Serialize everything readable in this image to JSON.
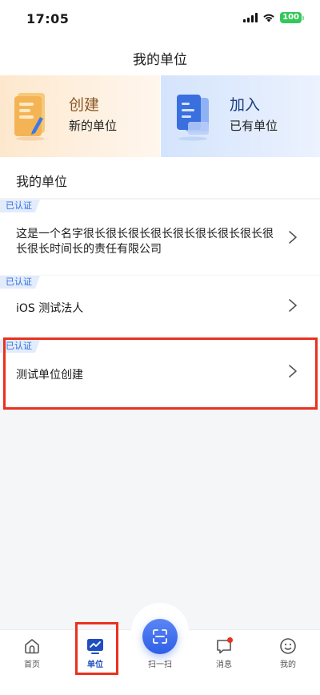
{
  "status_bar": {
    "time": "17:05",
    "battery": "100",
    "colors": {
      "battery": "#34c759"
    }
  },
  "nav": {
    "title": "我的单位"
  },
  "banners": {
    "create": {
      "title": "创建",
      "subtitle": "新的单位",
      "icon": "notebook-pen-icon"
    },
    "join": {
      "title": "加入",
      "subtitle": "已有单位",
      "icon": "documents-icon"
    }
  },
  "section": {
    "title": "我的单位"
  },
  "units": [
    {
      "badge": "已认证",
      "name": "这是一个名字很长很长很长很长很长很长很长很长很长很长时间长的责任有限公司"
    },
    {
      "badge": "已认证",
      "name": "iOS 测试法人"
    },
    {
      "badge": "已认证",
      "name": "测试单位创建"
    }
  ],
  "tabbar": {
    "items": [
      {
        "label": "首页",
        "icon": "home-icon"
      },
      {
        "label": "单位",
        "icon": "unit-chart-icon",
        "active": true
      },
      {
        "label": "扫一扫",
        "icon": "scan-icon"
      },
      {
        "label": "消息",
        "icon": "message-icon"
      },
      {
        "label": "我的",
        "icon": "smiley-icon"
      }
    ]
  },
  "colors": {
    "accent": "#2f5fe6",
    "badge_text": "#2f6de0",
    "badge_bg": "#e3ecfb",
    "highlight": "#e8321f",
    "notification_dot": "#e8321f"
  }
}
